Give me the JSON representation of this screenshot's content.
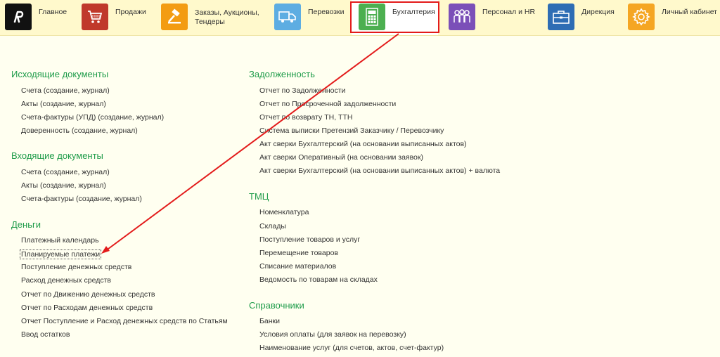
{
  "nav": [
    {
      "label": "Главное",
      "icon": "logo-icon",
      "color": "#111111"
    },
    {
      "label": "Продажи",
      "icon": "cart-icon",
      "color": "#c0392b"
    },
    {
      "label": "Заказы,  Аукционы,\nТендеры",
      "icon": "hammer-icon",
      "color": "#f39c12"
    },
    {
      "label": "Перевозки",
      "icon": "truck-icon",
      "color": "#5dade2"
    },
    {
      "label": "Бухгалтерия",
      "icon": "calculator-icon",
      "color": "#4caf50"
    },
    {
      "label": "Персонал и HR",
      "icon": "people-icon",
      "color": "#7b4fb8"
    },
    {
      "label": "Дирекция",
      "icon": "briefcase-icon",
      "color": "#2e6db4"
    },
    {
      "label": "Личный кабинет",
      "icon": "gear-icon",
      "color": "#f5a623"
    }
  ],
  "left_sections": [
    {
      "title": "Исходящие документы",
      "items": [
        "Счета (создание, журнал)",
        "Акты (создание, журнал)",
        "Счета-фактуры (УПД) (создание, журнал)",
        "Доверенность (создание, журнал)"
      ]
    },
    {
      "title": "Входящие документы",
      "items": [
        "Счета (создание, журнал)",
        "Акты (создание, журнал)",
        "Счета-фактуры (создание, журнал)"
      ]
    },
    {
      "title": "Деньги",
      "items": [
        "Платежный календарь",
        "Планируемые платежи",
        "Поступление денежных средств",
        "Расход денежных средств",
        "Отчет по Движению денежных средств",
        "Отчет по Расходам денежных средств",
        "Отчет Поступление и Расход денежных средств по Статьям",
        "Ввод остатков"
      ]
    }
  ],
  "right_sections": [
    {
      "title": "Задолженность",
      "items": [
        "Отчет по Задолженности",
        "Отчет по Просроченной задолженности",
        "Отчет по возврату ТН, ТТН",
        "Система выписки Претензий Заказчику / Перевозчику",
        "Акт сверки Бухгалтерский (на основании выписанных актов)",
        "Акт сверки Оперативный (на основании заявок)",
        "Акт сверки Бухгалтерский (на основании выписанных актов) + валюта"
      ]
    },
    {
      "title": "ТМЦ",
      "items": [
        "Номенклатура",
        "Склады",
        "Поступление товаров и услуг",
        "Перемещение товаров",
        "Списание материалов",
        "Ведомость по товарам на складах"
      ]
    },
    {
      "title": "Справочники",
      "items": [
        "Банки",
        "Условия оплаты (для заявок на перевозку)",
        "Наименование услуг (для счетов, актов, счет-фактур)"
      ]
    }
  ],
  "colors": {
    "section_title": "#1f9c4a",
    "annotation": "#e31b1b",
    "topbar_bg": "#fff9cc"
  }
}
